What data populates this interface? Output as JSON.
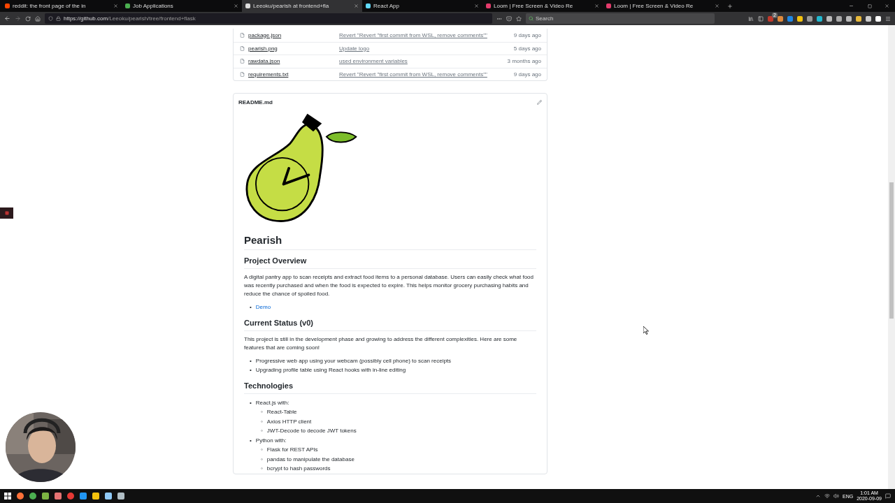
{
  "browser": {
    "tabs": [
      {
        "title": "reddit: the front page of the in",
        "selected": false
      },
      {
        "title": "Job Applications",
        "selected": false
      },
      {
        "title": "Leeoku/pearish at frontend+fla",
        "selected": true
      },
      {
        "title": "React App",
        "selected": false
      },
      {
        "title": "Loom | Free Screen & Video Re",
        "selected": false
      },
      {
        "title": "Loom | Free Screen & Video Re",
        "selected": false
      }
    ],
    "address_host": "https://github.com",
    "address_path": "/Leeoku/pearish/tree/frontend+flask",
    "search": {
      "placeholder": "Search"
    },
    "extension_badge": "2"
  },
  "files": [
    {
      "name": "package.json",
      "message": "Revert \"Revert \"first commit from WSL, remove comments\"\"",
      "age": "9 days ago"
    },
    {
      "name": "pearish.png",
      "message": "Update logo",
      "age": "5 days ago"
    },
    {
      "name": "rawdata.json",
      "message": "used environment variables",
      "age": "3 months ago"
    },
    {
      "name": "requirements.txt",
      "message": "Revert \"Revert \"first commit from WSL, remove comments\"\"",
      "age": "9 days ago"
    }
  ],
  "readme": {
    "filename": "README.md",
    "blocks": [
      {
        "kind": "h1",
        "text": "Pearish"
      },
      {
        "kind": "h2",
        "text": "Project Overview"
      },
      {
        "kind": "p",
        "text": "A digital pantry app to scan receipts and extract food items to a personal database. Users can easily check what food was recently purchased and when the food is expected to expire. This helps monitor grocery purchasing habits and reduce the chance of spoiled food."
      },
      {
        "kind": "list",
        "items": [
          {
            "marker": "•",
            "text": "Demo",
            "kind": "link"
          }
        ]
      },
      {
        "kind": "h2",
        "text": "Current Status (v0)"
      },
      {
        "kind": "p",
        "text": "This project is still in the development phase and growing to address the different complexities. Here are some features that are coming soon!"
      },
      {
        "kind": "list",
        "items": [
          {
            "marker": "•",
            "text": "Progressive web app using your webcam (possibly cell phone) to scan receipts",
            "kind": "text"
          },
          {
            "marker": "•",
            "text": "Upgrading profile table using React hooks with in-line editing",
            "kind": "text"
          }
        ]
      },
      {
        "kind": "h2",
        "text": "Technologies"
      },
      {
        "kind": "list",
        "items": [
          {
            "marker": "•",
            "text": "React.js with:",
            "kind": "text",
            "children": [
              {
                "marker": "◦",
                "text": "React-Table",
                "kind": "text"
              },
              {
                "marker": "◦",
                "text": "Axios HTTP client",
                "kind": "text"
              },
              {
                "marker": "◦",
                "text": "JWT-Decode to decode JWT tokens",
                "kind": "text"
              }
            ]
          },
          {
            "marker": "•",
            "text": "Python with:",
            "kind": "text",
            "children": [
              {
                "marker": "◦",
                "text": "Flask for REST APIs",
                "kind": "text"
              },
              {
                "marker": "◦",
                "text": "pandas to manipulate the database",
                "kind": "text"
              },
              {
                "marker": "◦",
                "text": "bcrypt to hash passwords",
                "kind": "text"
              }
            ]
          }
        ]
      }
    ]
  },
  "taskbar": {
    "language": "ENG",
    "time": "1:01 AM",
    "date": "2020-09-09"
  }
}
